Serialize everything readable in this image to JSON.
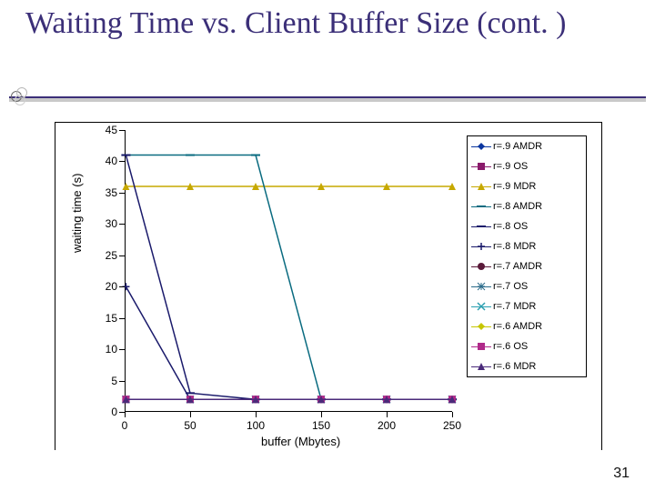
{
  "title": "Waiting Time vs. Client Buffer Size (cont. )",
  "page_number": "31",
  "chart_data": {
    "type": "line",
    "title": "",
    "xlabel": "buffer (Mbytes)",
    "ylabel": "waiting time (s)",
    "xlim": [
      0,
      250
    ],
    "ylim": [
      0,
      45
    ],
    "xticks": [
      0,
      50,
      100,
      150,
      200,
      250
    ],
    "yticks": [
      0,
      5,
      10,
      15,
      20,
      25,
      30,
      35,
      40,
      45
    ],
    "x": [
      1,
      50,
      100,
      150,
      200,
      250
    ],
    "series": [
      {
        "name": "r=.9 AMDR",
        "color": "#0a36a0",
        "marker": "diamond",
        "values": [
          2,
          2,
          2,
          2,
          2,
          2
        ]
      },
      {
        "name": "r=.9 OS",
        "color": "#8a1a6b",
        "marker": "square",
        "values": [
          2,
          2,
          2,
          2,
          2,
          2
        ]
      },
      {
        "name": "r=.9 MDR",
        "color": "#c6a800",
        "marker": "triangle",
        "values": [
          36,
          36,
          36,
          36,
          36,
          36
        ]
      },
      {
        "name": "r=.8 AMDR",
        "color": "#0a6b80",
        "marker": "hline",
        "values": [
          41,
          41,
          41,
          2,
          2,
          2
        ]
      },
      {
        "name": "r=.8 OS",
        "color": "#1a1a6b",
        "marker": "hline",
        "values": [
          41,
          3,
          2,
          2,
          2,
          2
        ]
      },
      {
        "name": "r=.8 MDR",
        "color": "#1a1a6b",
        "marker": "plus",
        "values": [
          20,
          2,
          2,
          2,
          2,
          2
        ]
      },
      {
        "name": "r=.7 AMDR",
        "color": "#5a1a3a",
        "marker": "dot",
        "values": [
          2,
          2,
          2,
          2,
          2,
          2
        ]
      },
      {
        "name": "r=.7 OS",
        "color": "#2a6b8a",
        "marker": "asterisk",
        "values": [
          2,
          2,
          2,
          2,
          2,
          2
        ]
      },
      {
        "name": "r=.7 MDR",
        "color": "#2a9fb0",
        "marker": "x",
        "values": [
          2,
          2,
          2,
          2,
          2,
          2
        ]
      },
      {
        "name": "r=.6 AMDR",
        "color": "#c6c600",
        "marker": "diamond",
        "values": [
          2,
          2,
          2,
          2,
          2,
          2
        ]
      },
      {
        "name": "r=.6 OS",
        "color": "#b02a8a",
        "marker": "square",
        "values": [
          2,
          2,
          2,
          2,
          2,
          2
        ]
      },
      {
        "name": "r=.6 MDR",
        "color": "#4a2a7a",
        "marker": "triangle",
        "values": [
          2,
          2,
          2,
          2,
          2,
          2
        ]
      }
    ]
  }
}
